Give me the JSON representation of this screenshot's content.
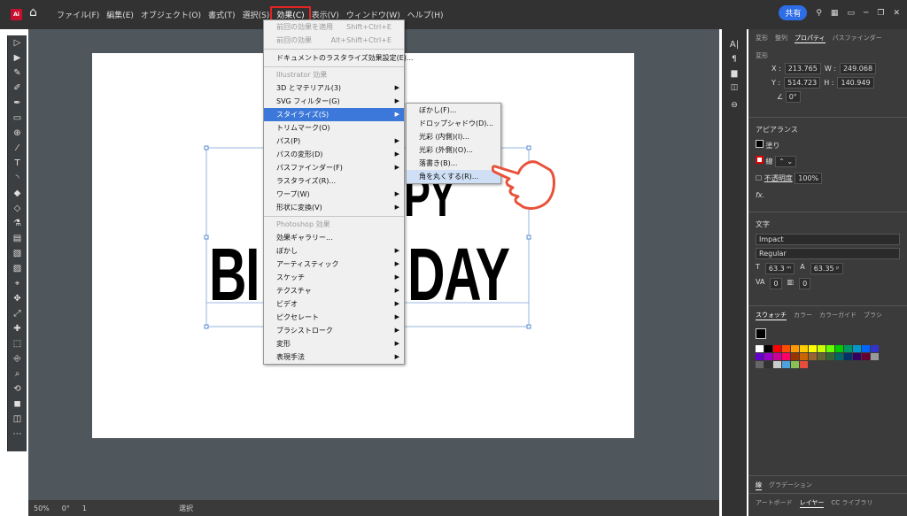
{
  "menubar": {
    "items": [
      "ファイル(F)",
      "編集(E)",
      "オブジェクト(O)",
      "書式(T)",
      "選択(S)",
      "効果(C)",
      "表示(V)",
      "ウィンドウ(W)",
      "ヘルプ(H)"
    ],
    "active": "効果(C)"
  },
  "topright": {
    "share": "共有"
  },
  "artwork": {
    "line1": "PY",
    "line2_left": "BI",
    "line2_right": "DAY"
  },
  "effect_menu": {
    "items": [
      {
        "label": "前回の効果を適用",
        "shortcut": "Shift+Ctrl+E",
        "disabled": true
      },
      {
        "label": "前回の効果",
        "shortcut": "Alt+Shift+Ctrl+E",
        "disabled": true
      },
      {
        "sep": true
      },
      {
        "label": "ドキュメントのラスタライズ効果設定(E)..."
      },
      {
        "sep": true
      },
      {
        "group": "Illustrator 効果"
      },
      {
        "label": "3D とマテリアル(3)",
        "arrow": true
      },
      {
        "label": "SVG フィルター(G)",
        "arrow": true
      },
      {
        "label": "スタイライズ(S)",
        "arrow": true,
        "highlight": true
      },
      {
        "label": "トリムマーク(O)"
      },
      {
        "label": "パス(P)",
        "arrow": true
      },
      {
        "label": "パスの変形(D)",
        "arrow": true
      },
      {
        "label": "パスファインダー(F)",
        "arrow": true
      },
      {
        "label": "ラスタライズ(R)..."
      },
      {
        "label": "ワープ(W)",
        "arrow": true
      },
      {
        "label": "形状に変換(V)",
        "arrow": true
      },
      {
        "sep": true
      },
      {
        "group": "Photoshop 効果"
      },
      {
        "label": "効果ギャラリー..."
      },
      {
        "label": "ぼかし",
        "arrow": true
      },
      {
        "label": "アーティスティック",
        "arrow": true
      },
      {
        "label": "スケッチ",
        "arrow": true
      },
      {
        "label": "テクスチャ",
        "arrow": true
      },
      {
        "label": "ビデオ",
        "arrow": true
      },
      {
        "label": "ピクセレート",
        "arrow": true
      },
      {
        "label": "ブラシストローク",
        "arrow": true
      },
      {
        "label": "変形",
        "arrow": true
      },
      {
        "label": "表現手法",
        "arrow": true
      }
    ]
  },
  "stylize_submenu": {
    "items": [
      "ぼかし(F)...",
      "ドロップシャドウ(D)...",
      "光彩 (内側)(I)...",
      "光彩 (外側)(O)...",
      "落書き(B)...",
      "角を丸くする(R)..."
    ],
    "highlight_index": 5
  },
  "panel": {
    "tabs": [
      "変形",
      "整列",
      "プロパティ",
      "パスファインダー"
    ],
    "active_tab": "プロパティ",
    "transform_label": "変形",
    "x_label": "X :",
    "x": "213.765",
    "w_label": "W :",
    "w": "249.068",
    "y_label": "Y :",
    "y": "514.723",
    "h_label": "H :",
    "h": "140.949",
    "angle": "0°",
    "appearance_title": "アピアランス",
    "fill": "塗り",
    "stroke": "線",
    "opacity_label": "不透明度",
    "opacity": "100%",
    "fx": "fx.",
    "char_title": "文字",
    "font": "Impact",
    "style": "Regular",
    "size": "63.3 ᵐ",
    "leading": "63.35 ᵖ",
    "tracking": "0",
    "kerning": "0",
    "bottom_tabs": [
      "スウォッチ",
      "カラー",
      "カラーガイド",
      "ブラシ"
    ],
    "footer_tabs": [
      "線",
      "グラデーション"
    ],
    "footer_tabs2": [
      "アートボード",
      "レイヤー",
      "CC ライブラリ"
    ]
  },
  "status": {
    "zoom": "50%",
    "angle": "0°",
    "page": "1",
    "mode": "選択"
  },
  "colors": {
    "accent": "#3b78d9",
    "highlight_box": "#e02424",
    "hand": "#e8523a"
  },
  "swatch_colors": [
    "#ffffff",
    "#000000",
    "#ff0000",
    "#ff4d00",
    "#ff9900",
    "#ffcc00",
    "#ffff00",
    "#ccff00",
    "#66ff00",
    "#00cc00",
    "#009966",
    "#0099cc",
    "#0066ff",
    "#3333cc",
    "#6600cc",
    "#9900cc",
    "#cc0099",
    "#ff0066",
    "#993300",
    "#cc6600",
    "#996633",
    "#666633",
    "#336633",
    "#006666",
    "#003366",
    "#330066",
    "#660033",
    "#999999",
    "#666666",
    "#333333",
    "#cccccc",
    "#4ca3dd",
    "#88c057",
    "#e84c3d"
  ]
}
